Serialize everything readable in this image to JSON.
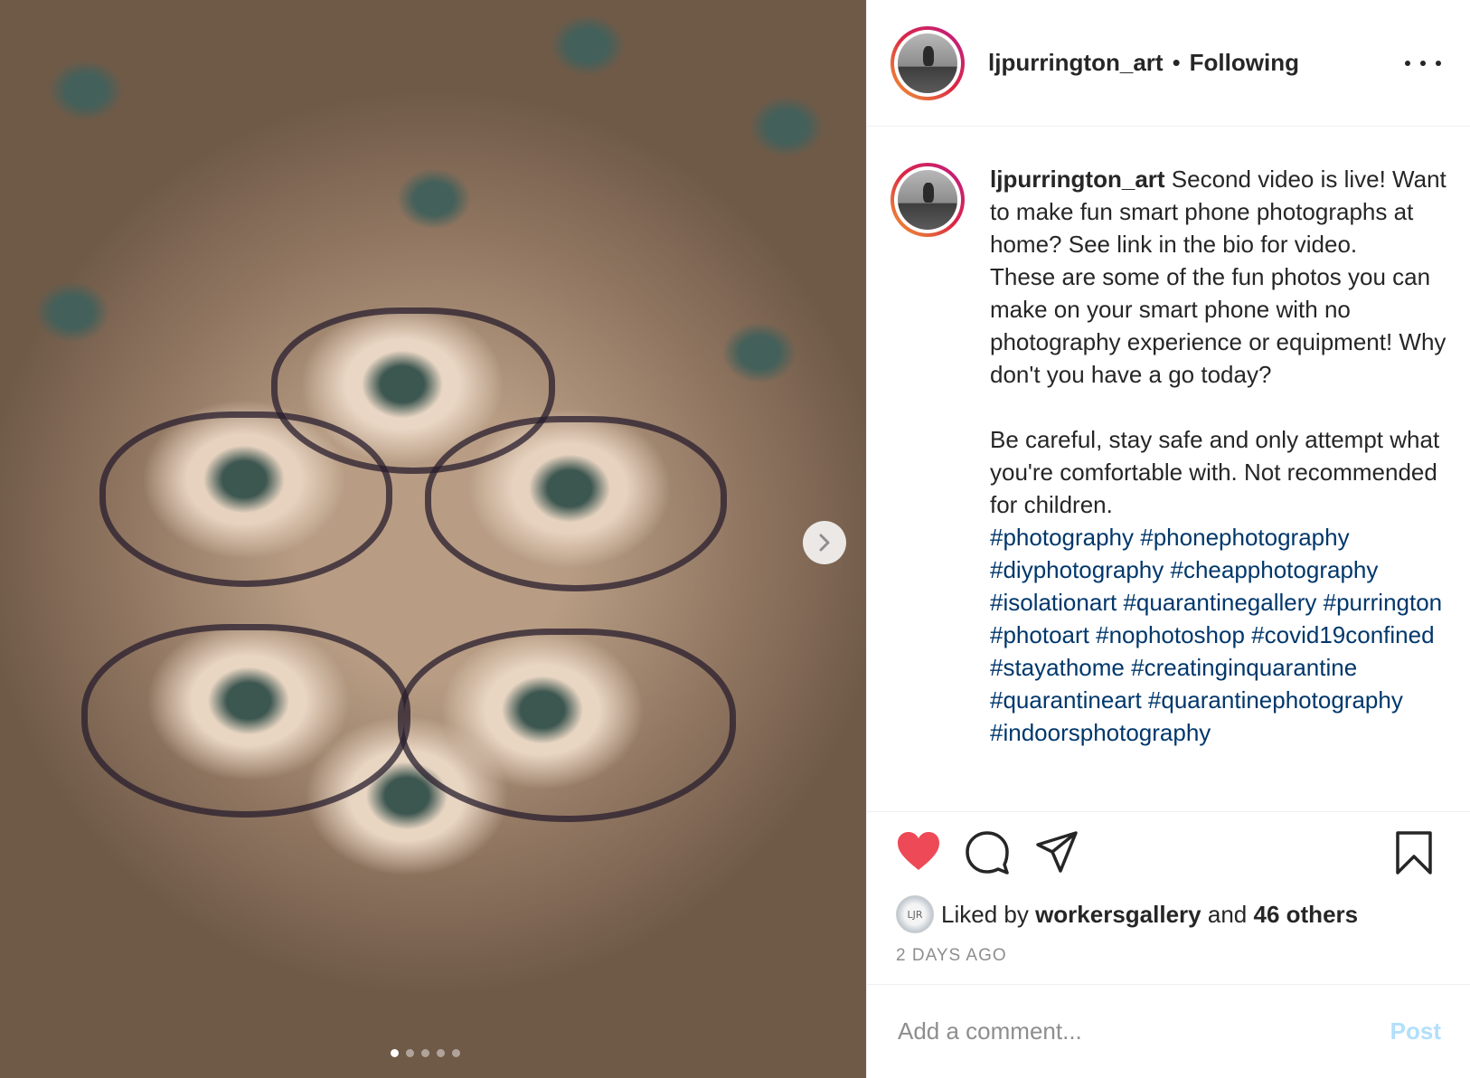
{
  "account": {
    "username": "ljpurrington_art",
    "separator": "•",
    "follow_status": "Following"
  },
  "caption": {
    "username": "ljpurrington_art",
    "paragraph1": "Second video is live! Want to make fun smart phone photographs at home? See link in the bio for video.",
    "paragraph2": "These are some of the fun photos you can make on your smart phone with no photography experience or equipment! Why don't you have a go today?",
    "paragraph3": "Be careful, stay safe and only attempt what you're comfortable with. Not recommended for children.",
    "hashtags": [
      "#photography",
      "#phonephotography",
      "#diyphotography",
      "#cheapphotography",
      "#isolationart",
      "#quarantinegallery",
      "#purrington",
      "#photoart",
      "#nophotoshop",
      "#covid19confined",
      "#stayathome",
      "#creatinginquarantine",
      "#quarantineart",
      "#quarantinephotography",
      "#indoorsphotography"
    ]
  },
  "actions": {
    "like_icon": "heart-filled-icon",
    "comment_icon": "comment-icon",
    "share_icon": "paper-plane-icon",
    "save_icon": "bookmark-icon",
    "like_color": "#ed4956"
  },
  "likes": {
    "prefix": "Liked by",
    "liker": "workersgallery",
    "conjunction": "and",
    "others": "46 others",
    "liker_avatar_text": "LJR"
  },
  "timestamp": "2 DAYS AGO",
  "comment_box": {
    "placeholder": "Add a comment...",
    "post_label": "Post"
  },
  "carousel": {
    "total_slides": 5,
    "active_index": 0
  }
}
